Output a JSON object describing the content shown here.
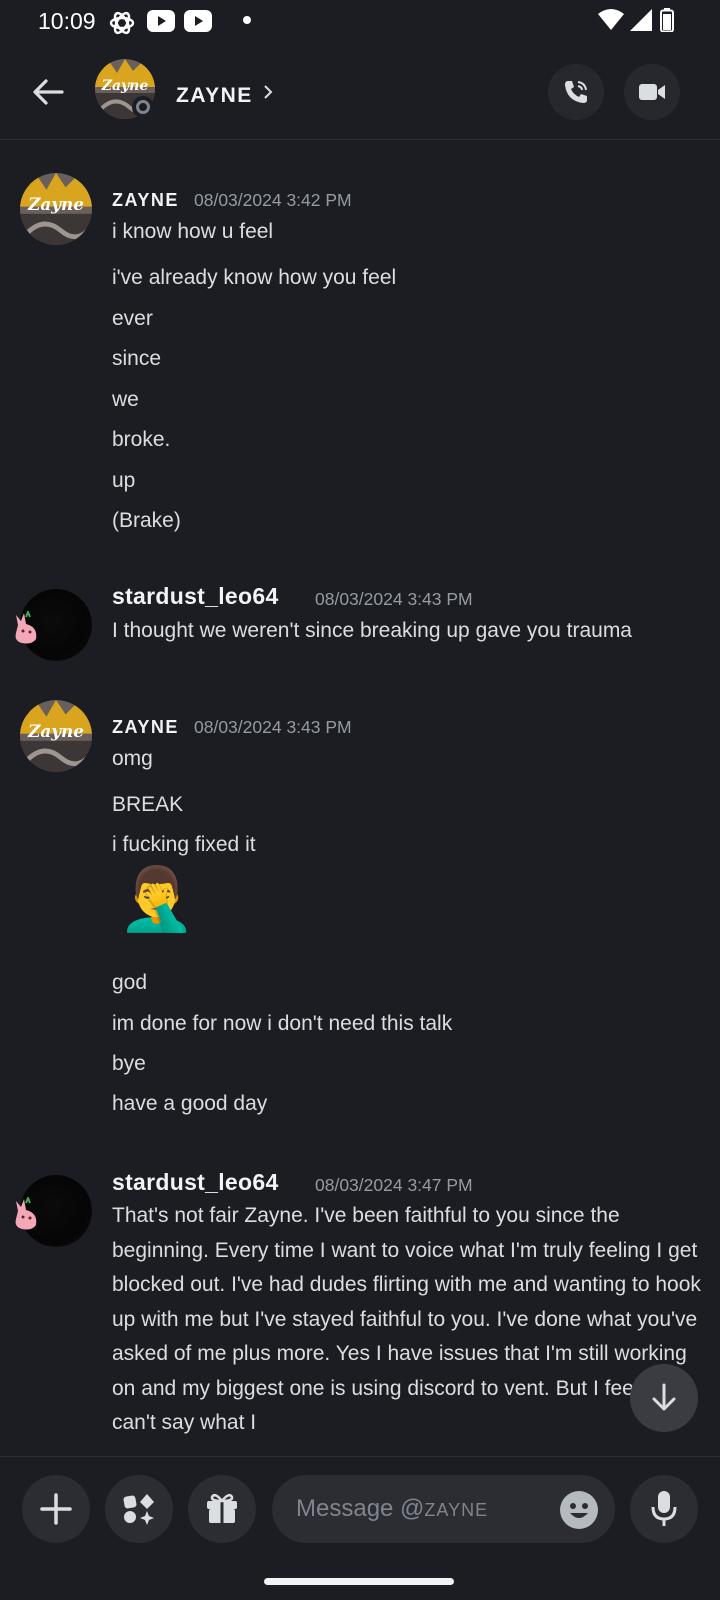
{
  "status_bar": {
    "time": "10:09"
  },
  "header": {
    "contact_name": "ZAYNE",
    "avatar_text": "Zayne",
    "back_icon": "arrow-left-icon",
    "call_icon": "phone-call-icon",
    "video_icon": "video-camera-icon"
  },
  "messages": [
    {
      "username": "ZAYNE",
      "timestamp": "08/03/2024 3:42 PM",
      "avatar_text": "Zayne",
      "lines": [
        "i know how u feel",
        "i've already know how you feel",
        "ever",
        "since",
        "we",
        "broke.",
        "up",
        "(Brake)"
      ]
    },
    {
      "username": "stardust_leo64",
      "timestamp": "08/03/2024 3:43 PM",
      "lines": [
        "I thought we weren't since breaking up gave you trauma"
      ]
    },
    {
      "username": "ZAYNE",
      "timestamp": "08/03/2024 3:43 PM",
      "avatar_text": "Zayne",
      "lines": [
        "omg",
        "BREAK",
        "i fucking fixed it",
        "god",
        "im done for now i don't need this talk",
        "bye",
        "have a good day"
      ],
      "emoji": "🤦‍♂️"
    },
    {
      "username": "stardust_leo64",
      "timestamp": "08/03/2024 3:47 PM",
      "text": "That's not fair Zayne. I've been faithful to you since the beginning. Every time I want to voice what I'm truly feeling I get blocked out. I've had dudes flirting with me and wanting to hook up with me but I've stayed faithful to you. I've done what you've asked of me plus more. Yes I have issues that I'm still working on and my biggest one is using discord to vent. But I feel like I can't say what I"
    }
  ],
  "input": {
    "placeholder": "Message @ZAYNE",
    "placeholder_prefix": "Message @",
    "placeholder_name": "ZAYNE"
  },
  "colors": {
    "background": "#1c1d22",
    "text": "#dbdee1",
    "muted": "#949ba4",
    "button_bg": "#2b2d33"
  }
}
